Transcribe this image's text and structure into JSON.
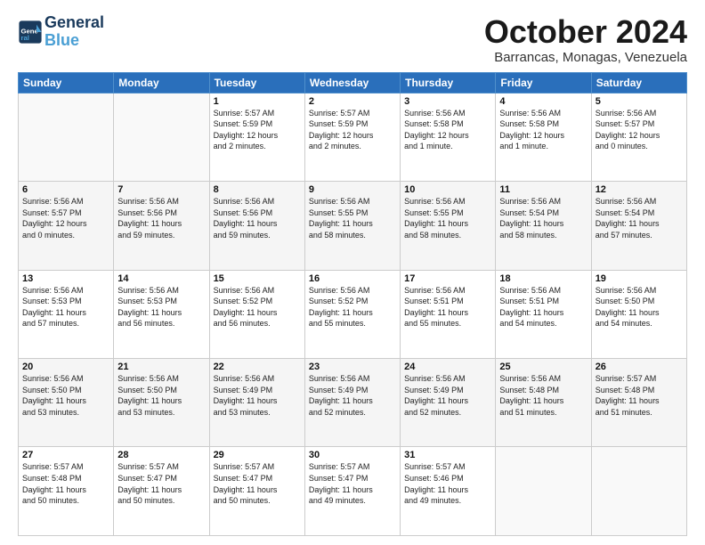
{
  "logo": {
    "text_general": "General",
    "text_blue": "Blue"
  },
  "header": {
    "month": "October 2024",
    "location": "Barrancas, Monagas, Venezuela"
  },
  "weekdays": [
    "Sunday",
    "Monday",
    "Tuesday",
    "Wednesday",
    "Thursday",
    "Friday",
    "Saturday"
  ],
  "weeks": [
    [
      {
        "day": "",
        "info": ""
      },
      {
        "day": "",
        "info": ""
      },
      {
        "day": "1",
        "info": "Sunrise: 5:57 AM\nSunset: 5:59 PM\nDaylight: 12 hours\nand 2 minutes."
      },
      {
        "day": "2",
        "info": "Sunrise: 5:57 AM\nSunset: 5:59 PM\nDaylight: 12 hours\nand 2 minutes."
      },
      {
        "day": "3",
        "info": "Sunrise: 5:56 AM\nSunset: 5:58 PM\nDaylight: 12 hours\nand 1 minute."
      },
      {
        "day": "4",
        "info": "Sunrise: 5:56 AM\nSunset: 5:58 PM\nDaylight: 12 hours\nand 1 minute."
      },
      {
        "day": "5",
        "info": "Sunrise: 5:56 AM\nSunset: 5:57 PM\nDaylight: 12 hours\nand 0 minutes."
      }
    ],
    [
      {
        "day": "6",
        "info": "Sunrise: 5:56 AM\nSunset: 5:57 PM\nDaylight: 12 hours\nand 0 minutes."
      },
      {
        "day": "7",
        "info": "Sunrise: 5:56 AM\nSunset: 5:56 PM\nDaylight: 11 hours\nand 59 minutes."
      },
      {
        "day": "8",
        "info": "Sunrise: 5:56 AM\nSunset: 5:56 PM\nDaylight: 11 hours\nand 59 minutes."
      },
      {
        "day": "9",
        "info": "Sunrise: 5:56 AM\nSunset: 5:55 PM\nDaylight: 11 hours\nand 58 minutes."
      },
      {
        "day": "10",
        "info": "Sunrise: 5:56 AM\nSunset: 5:55 PM\nDaylight: 11 hours\nand 58 minutes."
      },
      {
        "day": "11",
        "info": "Sunrise: 5:56 AM\nSunset: 5:54 PM\nDaylight: 11 hours\nand 58 minutes."
      },
      {
        "day": "12",
        "info": "Sunrise: 5:56 AM\nSunset: 5:54 PM\nDaylight: 11 hours\nand 57 minutes."
      }
    ],
    [
      {
        "day": "13",
        "info": "Sunrise: 5:56 AM\nSunset: 5:53 PM\nDaylight: 11 hours\nand 57 minutes."
      },
      {
        "day": "14",
        "info": "Sunrise: 5:56 AM\nSunset: 5:53 PM\nDaylight: 11 hours\nand 56 minutes."
      },
      {
        "day": "15",
        "info": "Sunrise: 5:56 AM\nSunset: 5:52 PM\nDaylight: 11 hours\nand 56 minutes."
      },
      {
        "day": "16",
        "info": "Sunrise: 5:56 AM\nSunset: 5:52 PM\nDaylight: 11 hours\nand 55 minutes."
      },
      {
        "day": "17",
        "info": "Sunrise: 5:56 AM\nSunset: 5:51 PM\nDaylight: 11 hours\nand 55 minutes."
      },
      {
        "day": "18",
        "info": "Sunrise: 5:56 AM\nSunset: 5:51 PM\nDaylight: 11 hours\nand 54 minutes."
      },
      {
        "day": "19",
        "info": "Sunrise: 5:56 AM\nSunset: 5:50 PM\nDaylight: 11 hours\nand 54 minutes."
      }
    ],
    [
      {
        "day": "20",
        "info": "Sunrise: 5:56 AM\nSunset: 5:50 PM\nDaylight: 11 hours\nand 53 minutes."
      },
      {
        "day": "21",
        "info": "Sunrise: 5:56 AM\nSunset: 5:50 PM\nDaylight: 11 hours\nand 53 minutes."
      },
      {
        "day": "22",
        "info": "Sunrise: 5:56 AM\nSunset: 5:49 PM\nDaylight: 11 hours\nand 53 minutes."
      },
      {
        "day": "23",
        "info": "Sunrise: 5:56 AM\nSunset: 5:49 PM\nDaylight: 11 hours\nand 52 minutes."
      },
      {
        "day": "24",
        "info": "Sunrise: 5:56 AM\nSunset: 5:49 PM\nDaylight: 11 hours\nand 52 minutes."
      },
      {
        "day": "25",
        "info": "Sunrise: 5:56 AM\nSunset: 5:48 PM\nDaylight: 11 hours\nand 51 minutes."
      },
      {
        "day": "26",
        "info": "Sunrise: 5:57 AM\nSunset: 5:48 PM\nDaylight: 11 hours\nand 51 minutes."
      }
    ],
    [
      {
        "day": "27",
        "info": "Sunrise: 5:57 AM\nSunset: 5:48 PM\nDaylight: 11 hours\nand 50 minutes."
      },
      {
        "day": "28",
        "info": "Sunrise: 5:57 AM\nSunset: 5:47 PM\nDaylight: 11 hours\nand 50 minutes."
      },
      {
        "day": "29",
        "info": "Sunrise: 5:57 AM\nSunset: 5:47 PM\nDaylight: 11 hours\nand 50 minutes."
      },
      {
        "day": "30",
        "info": "Sunrise: 5:57 AM\nSunset: 5:47 PM\nDaylight: 11 hours\nand 49 minutes."
      },
      {
        "day": "31",
        "info": "Sunrise: 5:57 AM\nSunset: 5:46 PM\nDaylight: 11 hours\nand 49 minutes."
      },
      {
        "day": "",
        "info": ""
      },
      {
        "day": "",
        "info": ""
      }
    ]
  ]
}
